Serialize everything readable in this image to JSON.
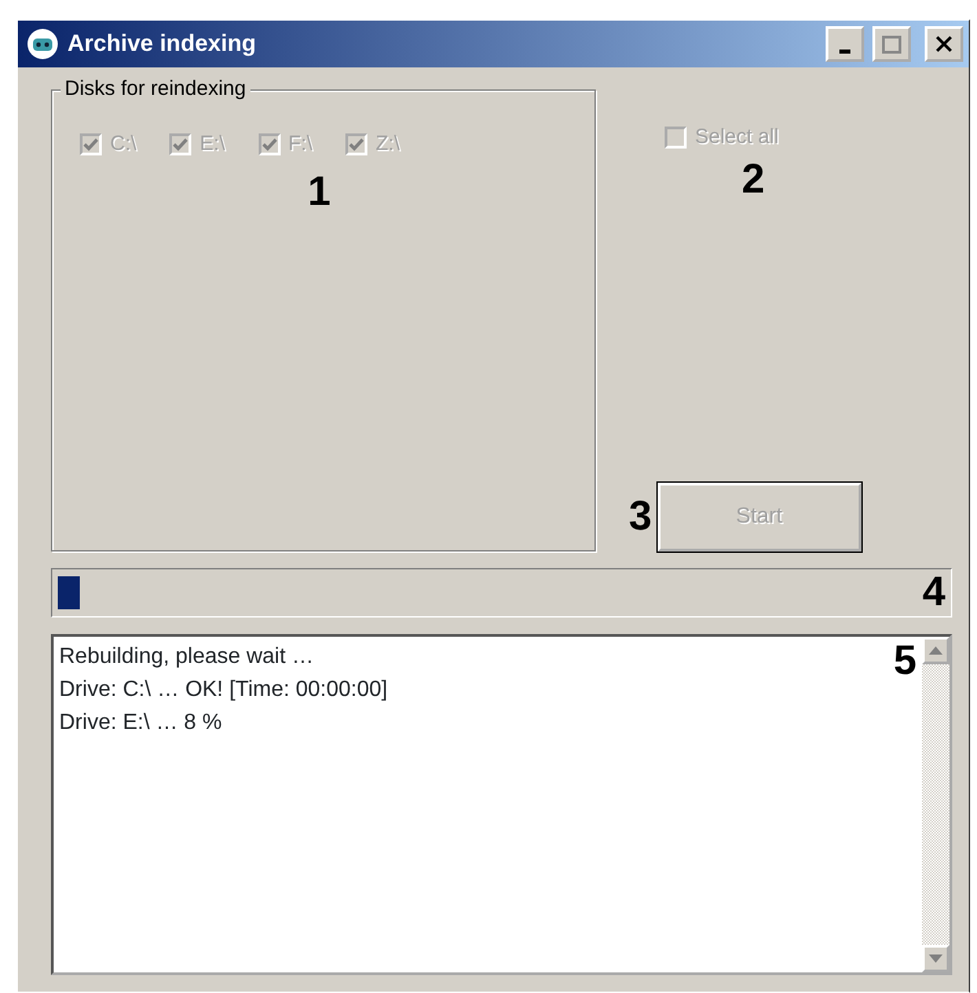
{
  "window": {
    "title": "Archive indexing"
  },
  "disks_group": {
    "title": "Disks for reindexing",
    "callout": "1",
    "disks": [
      {
        "label": "C:\\",
        "checked": true,
        "disabled": true
      },
      {
        "label": "E:\\",
        "checked": true,
        "disabled": true
      },
      {
        "label": "F:\\",
        "checked": true,
        "disabled": true
      },
      {
        "label": "Z:\\",
        "checked": true,
        "disabled": true
      }
    ]
  },
  "select_all": {
    "label": "Select all",
    "checked": false,
    "disabled": true,
    "callout": "2"
  },
  "start_button": {
    "label": "Start",
    "disabled": true,
    "callout": "3"
  },
  "progress": {
    "level": 0.025,
    "callout": "4"
  },
  "log": {
    "callout": "5",
    "lines": [
      "Rebuilding, please wait …",
      "Drive: C:\\ … OK! [Time: 00:00:00]",
      "Drive: E:\\ … 8 %"
    ]
  }
}
